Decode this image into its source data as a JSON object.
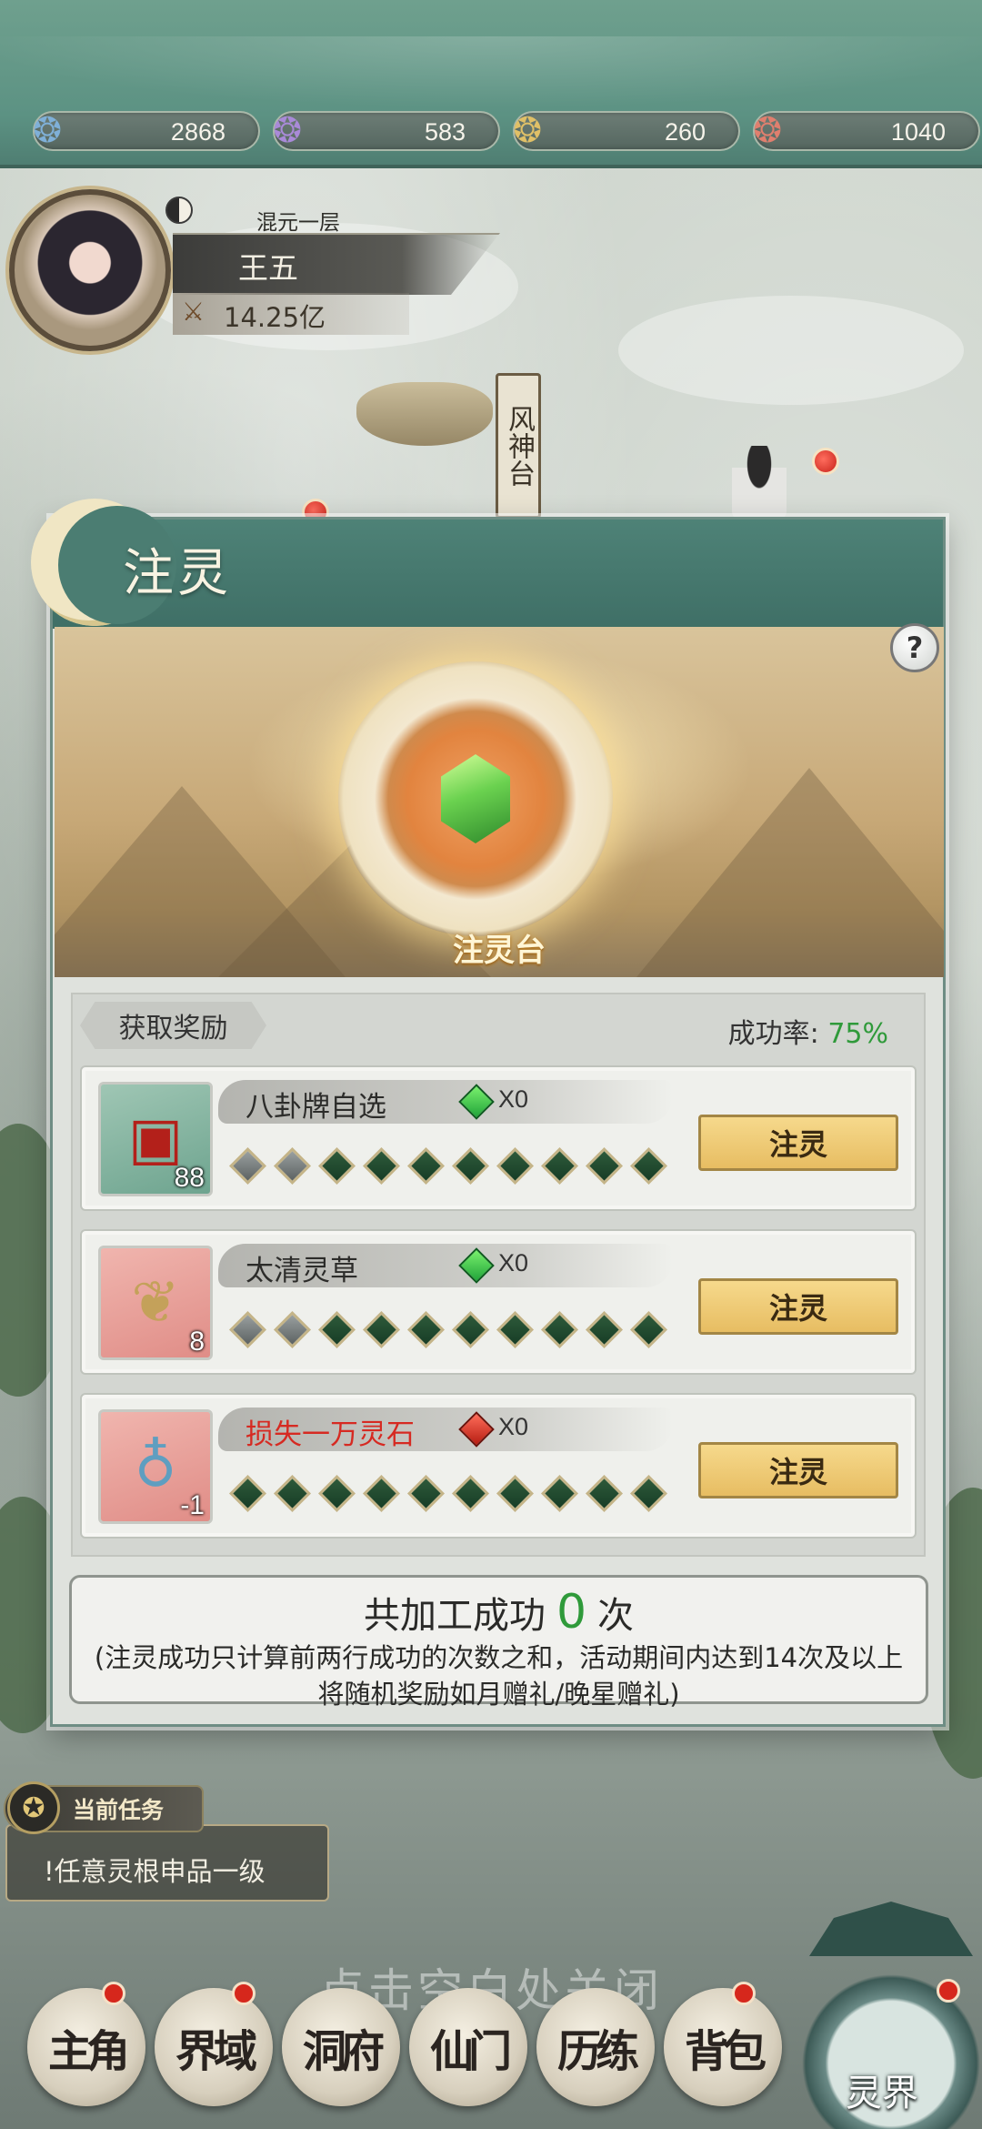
{
  "resources": [
    {
      "icon": "blue-spirit-icon",
      "value": "2868",
      "color": "#7fb0d8"
    },
    {
      "icon": "purple-spirit-icon",
      "value": "583",
      "color": "#a98ad8"
    },
    {
      "icon": "gold-spirit-icon",
      "value": "260",
      "color": "#e0c067"
    },
    {
      "icon": "red-spirit-icon",
      "value": "1040",
      "color": "#e07f6e"
    }
  ],
  "player": {
    "realm": "混元一层",
    "name": "王五",
    "power": "14.25亿"
  },
  "scene": {
    "pillar_text": "风神台"
  },
  "modal": {
    "title": "注灵",
    "altar_label": "注灵台",
    "help": "?",
    "reward_tab": "获取奖励",
    "rate_label": "成功率:",
    "rate_value": "75%",
    "rows": [
      {
        "name": "八卦牌自选",
        "name_color": "normal",
        "icon": "treasure-chest-icon",
        "count": "88",
        "gem": "green",
        "gem_count": "X0",
        "progress_done": 2,
        "progress_total": 10,
        "button": "注灵"
      },
      {
        "name": "太清灵草",
        "name_color": "normal",
        "icon": "ginseng-herb-icon",
        "count": "8",
        "gem": "green",
        "gem_count": "X0",
        "progress_done": 2,
        "progress_total": 10,
        "button": "注灵"
      },
      {
        "name": "损失一万灵石",
        "name_color": "red",
        "icon": "spirit-stone-bag-icon",
        "count": "-1",
        "gem": "red",
        "gem_count": "X0",
        "progress_done": 0,
        "progress_total": 10,
        "button": "注灵"
      }
    ],
    "summary_prefix": "共加工成功",
    "summary_count": "0",
    "summary_suffix": "次",
    "summary_note": "(注灵成功只计算前两行成功的次数之和，活动期间内达到14次及以上将随机奖励如月赠礼/晚星赠礼)"
  },
  "task": {
    "tag": "当前任务",
    "text": "!任意灵根申品一级"
  },
  "close_hint": "点击空白处关闭",
  "nav": [
    {
      "id": "main",
      "label": "主角"
    },
    {
      "id": "realm",
      "label": "界域"
    },
    {
      "id": "cave",
      "label": "洞府"
    },
    {
      "id": "sect",
      "label": "仙门"
    },
    {
      "id": "training",
      "label": "历练"
    },
    {
      "id": "bag",
      "label": "背包"
    }
  ],
  "spirit_world": "灵界"
}
